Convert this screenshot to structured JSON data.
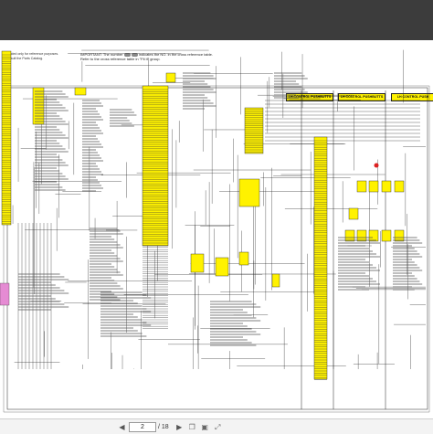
{
  "viewer": {
    "current_page": "2",
    "total_pages": "/ 18",
    "prev_icon": "caret-left-icon",
    "next_icon": "caret-right-icon",
    "tools": [
      "copy-icon",
      "page-icon",
      "fullscreen-icon"
    ]
  },
  "document": {
    "important_line1": "IMPORTANT: The number",
    "important_line1b": "indicates the NO. in the cross reference table.",
    "important_line2": "Refer to the cross reference table in \"Fit it\" group.",
    "left_note_line1": "...included only for reference purposes.",
    "left_note_line2": "to consult the Parts Catalog.",
    "headers": [
      "LH CONTROL PUSHBUTTS",
      "LH CONTROL PUSHBUTTS",
      "LH CONTROL PUSH"
    ]
  },
  "colors": {
    "highlight": "#fff200",
    "magenta": "#e040c0",
    "wire": "#222222",
    "toolbar": "#3c3c3c"
  }
}
